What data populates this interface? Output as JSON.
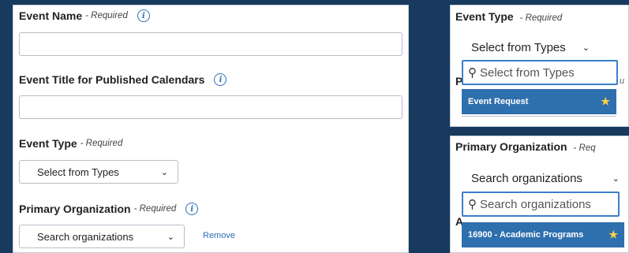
{
  "form": {
    "event_name": {
      "label": "Event Name",
      "required": "- Required"
    },
    "event_title": {
      "label": "Event Title for Published Calendars"
    },
    "event_type": {
      "label": "Event Type",
      "required": "- Required",
      "select_value": "Select from Types"
    },
    "primary_org": {
      "label": "Primary Organization",
      "required": "- Required",
      "select_value": "Search organizations",
      "remove_label": "Remove"
    }
  },
  "zoom_event_type": {
    "label": "Event Type",
    "required": "- Required",
    "select_value": "Select from Types",
    "search_placeholder": "Select from Types",
    "option": "Event Request",
    "ghost_p": "P",
    "ghost_u": "u"
  },
  "zoom_org": {
    "label": "Primary Organization",
    "required": "- Req",
    "select_value": "Search organizations",
    "search_placeholder": "Search organizations",
    "option": "16900 - Academic Programs",
    "ghost_a": "A"
  },
  "icons": {
    "info": "info-icon",
    "chevron": "chevron-down-icon",
    "search": "search-icon",
    "star": "star-icon"
  },
  "colors": {
    "background": "#173a5e",
    "accent": "#2f6fb5",
    "highlight": "#2e6fae",
    "star": "#ffd23f"
  }
}
